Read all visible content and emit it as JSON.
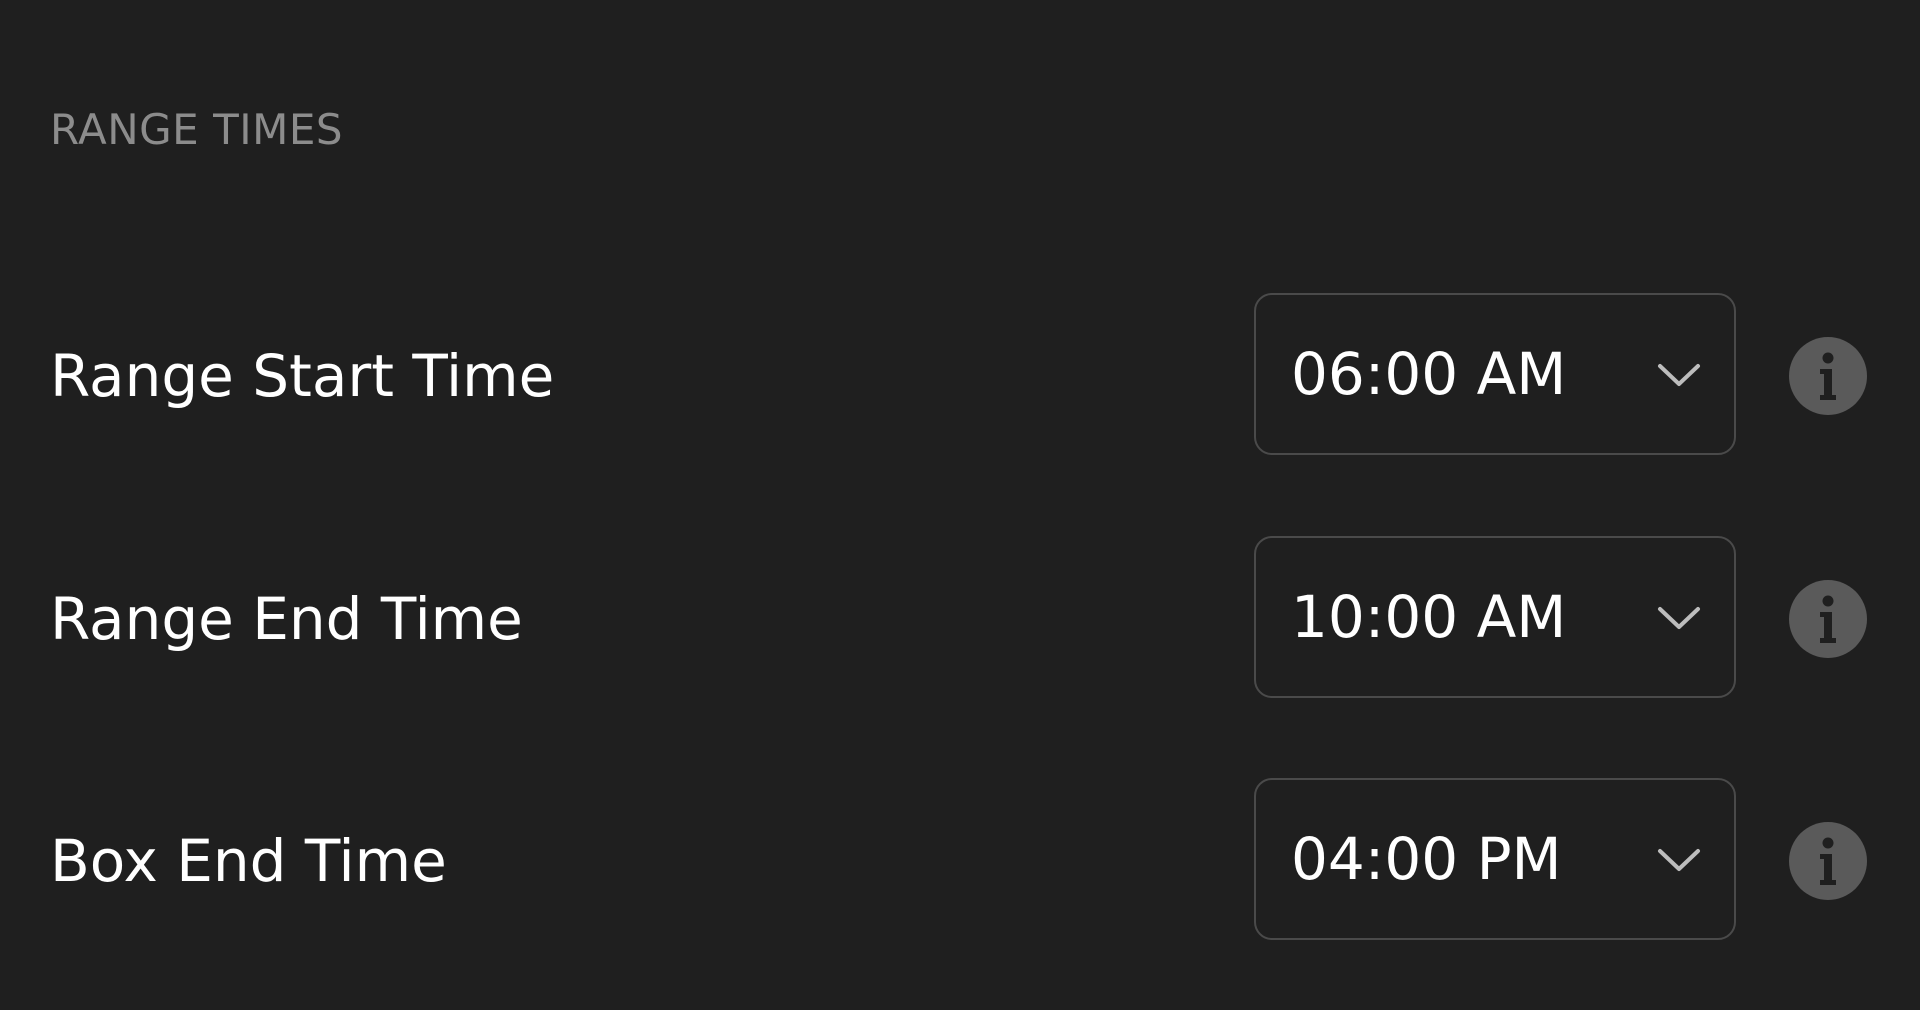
{
  "section": {
    "heading": "RANGE TIMES"
  },
  "settings": [
    {
      "label": "Range Start Time",
      "value": "06:00 AM",
      "icon": "info-icon"
    },
    {
      "label": "Range End Time",
      "value": "10:00 AM",
      "icon": "info-icon"
    },
    {
      "label": "Box End Time",
      "value": "04:00 PM",
      "icon": "info-icon"
    }
  ],
  "colors": {
    "background": "#1f1f1f",
    "heading": "#8c8c8c",
    "text": "#ffffff",
    "border": "#4a4a4a",
    "icon": "#5a5a5a"
  }
}
